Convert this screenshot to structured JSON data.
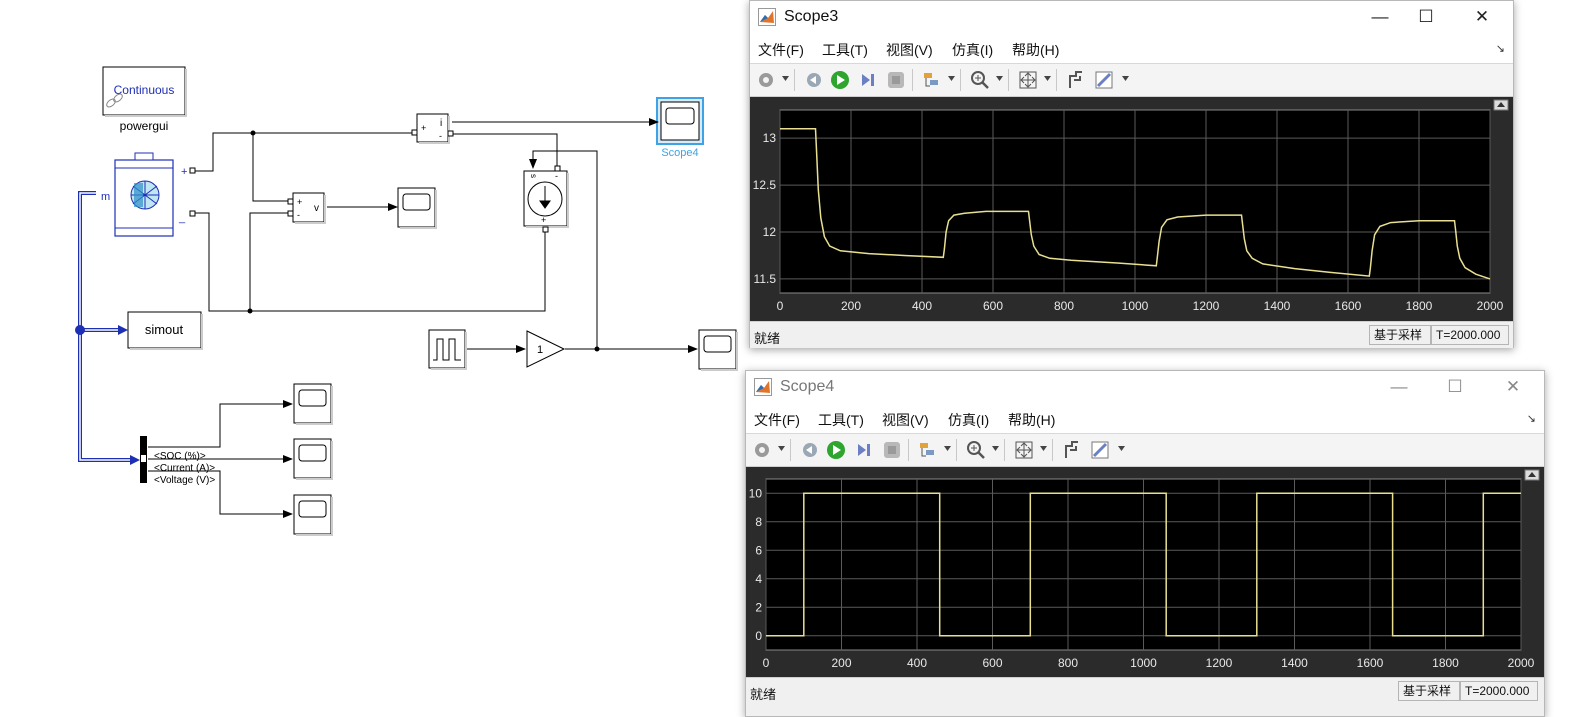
{
  "diagram": {
    "powergui": {
      "block_text": "Continuous",
      "label": "powergui"
    },
    "battery": {
      "plus": "+",
      "minus": "_",
      "m": "m"
    },
    "current_sensor": {
      "plus": "+",
      "minus": "-",
      "out": "i"
    },
    "voltage_sensor": {
      "plus": "+",
      "minus": "-",
      "out": "v"
    },
    "current_source": {
      "s": "s",
      "top_minus": "-",
      "plus": "+"
    },
    "gain": {
      "value": "1"
    },
    "simout": {
      "label": "simout"
    },
    "scope4": {
      "label": "Scope4"
    },
    "bus_signals": [
      "<SOC (%)>",
      "<Current (A)>",
      "<Voltage (V)>"
    ]
  },
  "menus": [
    "文件(F)",
    "工具(T)",
    "视图(V)",
    "仿真(I)",
    "帮助(H)"
  ],
  "windows": {
    "scope3": {
      "title": "Scope3",
      "status": "就绪",
      "sample_mode": "基于采样",
      "time": "T=2000.000",
      "controls": {
        "minimize": "—",
        "maximize": "☐",
        "close": "✕"
      }
    },
    "scope4": {
      "title": "Scope4",
      "status": "就绪",
      "sample_mode": "基于采样",
      "time": "T=2000.000",
      "controls": {
        "minimize": "—",
        "maximize": "☐",
        "close": "✕"
      }
    }
  },
  "toolbar_icons": [
    "settings-icon",
    "restore-icon",
    "run-icon",
    "step-forward-icon",
    "stop-icon",
    "trigger-icon",
    "zoom-icon",
    "fit-icon",
    "cursor-icon",
    "style-icon"
  ],
  "colors": {
    "trace": "#e8e090",
    "plot_bg": "#000000",
    "grid": "#5a5a5a",
    "selection": "#3ea2e4",
    "signal_blue": "#1d2fb5"
  },
  "chart_data": [
    {
      "type": "line",
      "title": "",
      "xlabel": "",
      "ylabel": "",
      "xlim": [
        0,
        2000
      ],
      "ylim": [
        11.35,
        13.3
      ],
      "xticks": [
        0,
        200,
        400,
        600,
        800,
        1000,
        1200,
        1400,
        1600,
        1800,
        2000
      ],
      "yticks": [
        11.5,
        12,
        12.5,
        13
      ],
      "ytick_labels": [
        "11.5",
        "12",
        "12.5",
        "13"
      ],
      "grid": true,
      "series": [
        {
          "x": [
            0,
            100,
            103,
            108,
            115,
            125,
            140,
            170,
            250,
            350,
            460,
            463,
            468,
            475,
            490,
            520,
            580,
            700,
            703,
            708,
            715,
            730,
            760,
            820,
            950,
            1060,
            1063,
            1068,
            1075,
            1090,
            1120,
            1200,
            1300,
            1303,
            1308,
            1315,
            1330,
            1360,
            1450,
            1550,
            1660,
            1663,
            1668,
            1675,
            1690,
            1720,
            1800,
            1900,
            1903,
            1908,
            1915,
            1930,
            1960,
            2000
          ],
          "y": [
            13.1,
            13.1,
            12.85,
            12.45,
            12.15,
            11.95,
            11.85,
            11.8,
            11.77,
            11.75,
            11.73,
            11.82,
            12.0,
            12.12,
            12.18,
            12.2,
            12.22,
            12.22,
            12.12,
            11.97,
            11.85,
            11.76,
            11.72,
            11.7,
            11.67,
            11.64,
            11.74,
            11.9,
            12.05,
            12.13,
            12.16,
            12.18,
            12.18,
            12.08,
            11.93,
            11.8,
            11.72,
            11.66,
            11.61,
            11.57,
            11.53,
            11.62,
            11.8,
            11.97,
            12.06,
            12.1,
            12.12,
            12.12,
            12.02,
            11.85,
            11.72,
            11.62,
            11.55,
            11.5
          ]
        }
      ]
    },
    {
      "type": "line",
      "title": "",
      "xlabel": "",
      "ylabel": "",
      "xlim": [
        0,
        2000
      ],
      "ylim": [
        -1,
        11
      ],
      "xticks": [
        0,
        200,
        400,
        600,
        800,
        1000,
        1200,
        1400,
        1600,
        1800,
        2000
      ],
      "yticks": [
        0,
        2,
        4,
        6,
        8,
        10
      ],
      "grid": true,
      "series": [
        {
          "x": [
            0,
            100,
            100,
            460,
            460,
            700,
            700,
            1060,
            1060,
            1300,
            1300,
            1660,
            1660,
            1900,
            1900,
            2000
          ],
          "y": [
            0,
            0,
            10,
            10,
            0,
            0,
            10,
            10,
            0,
            0,
            10,
            10,
            0,
            0,
            10,
            10
          ]
        }
      ]
    }
  ]
}
